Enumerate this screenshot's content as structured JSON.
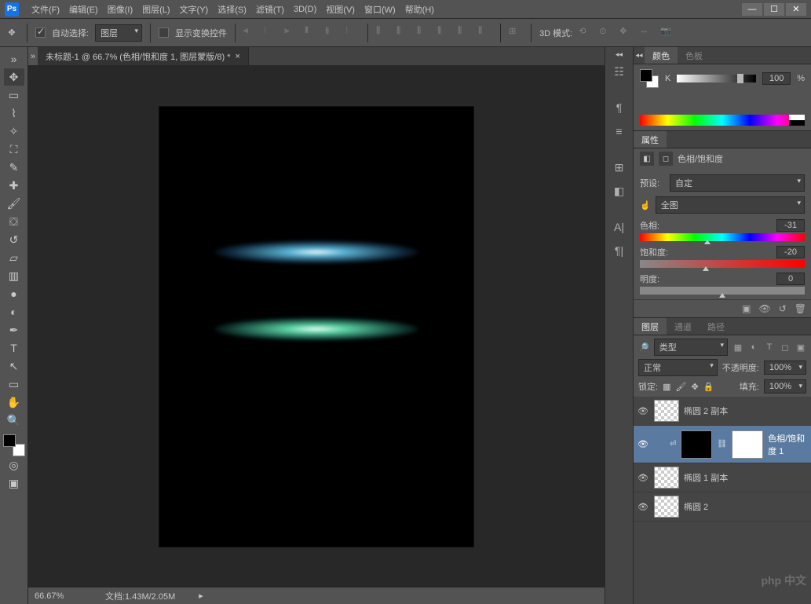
{
  "app_icon": "Ps",
  "menu": [
    "文件(F)",
    "编辑(E)",
    "图像(I)",
    "图层(L)",
    "文字(Y)",
    "选择(S)",
    "滤镜(T)",
    "3D(D)",
    "视图(V)",
    "窗口(W)",
    "帮助(H)"
  ],
  "window_ctrl": {
    "min": "—",
    "max": "☐",
    "close": "✕"
  },
  "optbar": {
    "auto_select": "自动选择:",
    "target": "图层",
    "show_transform": "显示变换控件",
    "mode_3d": "3D 模式:"
  },
  "doc_tab": "未标题-1 @ 66.7% (色相/饱和度 1, 图层蒙版/8) *",
  "status": {
    "zoom": "66.67%",
    "doc": "文档:1.43M/2.05M"
  },
  "color_panel": {
    "tabs": [
      "颜色",
      "色板"
    ],
    "channel": "K",
    "value": "100",
    "unit": "%"
  },
  "props_panel": {
    "tab": "属性",
    "title": "色相/饱和度",
    "preset_label": "预设:",
    "preset_value": "自定",
    "target": "全图",
    "hue_label": "色相:",
    "hue_value": "-31",
    "sat_label": "饱和度:",
    "sat_value": "-20",
    "light_label": "明度:",
    "light_value": "0"
  },
  "layers_panel": {
    "tabs": [
      "图层",
      "通道",
      "路径"
    ],
    "filter_label": "类型",
    "blend": "正常",
    "opacity_label": "不透明度:",
    "opacity": "100%",
    "lock_label": "锁定:",
    "fill_label": "填充:",
    "fill": "100%",
    "layers": [
      {
        "name": "椭圆 2 副本"
      },
      {
        "name": "色相/饱和度 1"
      },
      {
        "name": "椭圆 1 副本"
      },
      {
        "name": "椭圆 2"
      }
    ]
  },
  "watermark": "php 中文"
}
